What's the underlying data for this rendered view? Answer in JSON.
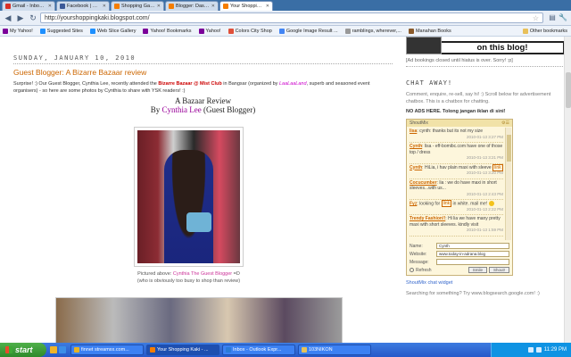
{
  "browser": {
    "tabs": [
      {
        "label": "Gmail - Inbox - soulquirky@...",
        "icon": "gmail-icon",
        "color": "#d93025",
        "active": false
      },
      {
        "label": "Facebook | Home",
        "icon": "facebook-icon",
        "color": "#3b5998",
        "active": false
      },
      {
        "label": "Shopping Gazebo",
        "icon": "blogger-icon",
        "color": "#f57d00",
        "active": false
      },
      {
        "label": "Blogger: Dashboard",
        "icon": "blogger-icon",
        "color": "#f57d00",
        "active": false
      },
      {
        "label": "Your Shopping Kaki - A Re...",
        "icon": "blogger-icon",
        "color": "#f57d00",
        "active": true
      }
    ],
    "url": "http://yourshoppingkaki.blogspot.com/",
    "bookmarks": [
      {
        "label": "My Yahoo!",
        "icon": "yahoo-icon",
        "color": "#7b0099"
      },
      {
        "label": "Suggested Sites",
        "icon": "ie-icon",
        "color": "#1e90ff"
      },
      {
        "label": "Web Slice Gallery",
        "icon": "ie-icon",
        "color": "#1e90ff"
      },
      {
        "label": "Yahoo! Bookmarks",
        "icon": "yahoo-icon",
        "color": "#7b0099"
      },
      {
        "label": "Yahoo!",
        "icon": "yahoo-icon",
        "color": "#7b0099"
      },
      {
        "label": "Colors City Shop",
        "icon": "page-icon",
        "color": "#e0503a"
      },
      {
        "label": "Google Image Result ...",
        "icon": "google-icon",
        "color": "#4285f4"
      },
      {
        "label": "ramblings, wherever,...",
        "icon": "page-icon",
        "color": "#999999"
      },
      {
        "label": "Manahan Books",
        "icon": "page-icon",
        "color": "#8a5a2b"
      }
    ],
    "other_bookmarks": "Other bookmarks"
  },
  "post": {
    "date": "SUNDAY, JANUARY 10, 2010",
    "title": "Guest Blogger: A Bizarre Bazaar review",
    "intro_a": "Surprise! :) Our Guest Blogger, Cynthia Lee, recently attended the ",
    "intro_event": "Bizarre Bazaar @ Mist Club",
    "intro_b": " in Bangsar (organized by ",
    "intro_org": "LaaLaaLand",
    "intro_c": ", superb and seasoned event organisers) - so here are some photos by Cynthia to share with YSK readers! :)",
    "review_title": "A Bazaar Review",
    "by": "By",
    "author": "Cynthia Lee",
    "author_role": "(Guest Blogger)",
    "caption_prefix": "Pictured above: ",
    "caption_name": "Cynthia The Guest Blogger",
    "caption_suffix": " =D",
    "caption_line2": "(who is obviously too busy to shop than review)"
  },
  "sidebar": {
    "banner_text": "on this blog!",
    "ad_note": "[Ad bookings closed until hiatus is over. Sorry! :p]",
    "chat_title": "CHAT AWAY!",
    "chat_text": "Comment, enquire, re-sell, say hi! :) Scroll below for advertisement chatbox. This is a chatbox for chatting.",
    "no_ads": "NO ADS HERE. Tolong jangan iklan di sini!",
    "shoutmix_label": "ShoutMix",
    "messages": [
      {
        "who": "lisa",
        "text": "cynth: thanks but its not my size",
        "time": "2010-01-13 3:27 PM"
      },
      {
        "who": "Cynth",
        "text": "lisa - eff-bomibc.com have one of those top / dress",
        "time": "2010-01-13 3:21 PM"
      },
      {
        "who": "Cynth",
        "text": "HiLia, i hav plain maxi with sleeve",
        "link": "link",
        "time": "2010-01-13 3:20 PM"
      },
      {
        "who": "Cocucumber",
        "text": "lia : we do have maxi in short sleeves...with us...",
        "time": "2010-01-13 2:43 PM"
      },
      {
        "who": "Fyz",
        "text": "looking for",
        "link": "link",
        "text2": "in white. mail me!",
        "time": "2010-01-13 2:22 PM"
      },
      {
        "who": "Trendy Fashion!!",
        "text": "Hi lia we have many pretty maxi with short sleeves. kindly visit",
        "time": "2010-01-13 1:59 PM"
      }
    ],
    "form": {
      "name_label": "Name:",
      "name_value": "Cynth",
      "website_label": "Website:",
      "website_value": "www.today-in-adrana.blog",
      "message_label": "Message:",
      "message_value": "",
      "refresh_label": "Refresh",
      "smile_label": "Smile",
      "shout_label": "Shout!"
    },
    "widget_link": "ShoutMix chat widget",
    "search_note": "Searching for something? Try www.blogsearch.google.com! :)"
  },
  "taskbar": {
    "start": "start",
    "buttons": [
      {
        "label": "finnet streamxx.com...",
        "color": "#e6b325",
        "active": false
      },
      {
        "label": "Your Shopping Kaki - ...",
        "color": "#f57d00",
        "active": true
      },
      {
        "label": "Inbox - Outlook Expr...",
        "color": "#2a7bd8",
        "active": false
      },
      {
        "label": "103NIKON",
        "color": "#e6c35a",
        "active": false
      }
    ],
    "clock": "11:29 PM"
  }
}
